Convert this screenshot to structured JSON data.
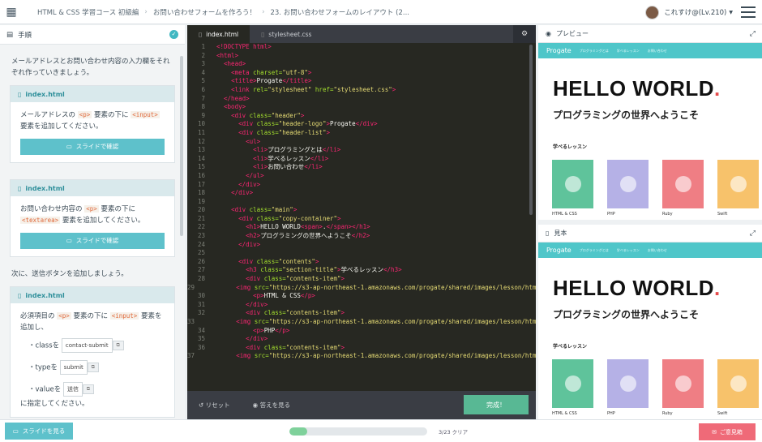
{
  "header": {
    "logo_icon": "progate-logo-icon",
    "breadcrumbs": [
      "HTML & CSS 学習コース 初級編",
      "お問い合わせフォームを作ろう！",
      "23. お問い合わせフォームのレイアウト (2..."
    ],
    "user_name": "これすけ@(Lv.210)",
    "menu_icon": "hamburger-icon"
  },
  "left_panel": {
    "title": "手順",
    "intro": "メールアドレスとお問い合わせ内容の入力欄をそれぞれ作っていきましょう。",
    "cards": [
      {
        "file": "index.html",
        "pre": "メールアドレスの",
        "code1": "<p>",
        "mid": "要素の下に",
        "code2": "<input>",
        "post": "要素を追加してください。",
        "button": "スライドで確認"
      },
      {
        "file": "index.html",
        "pre": "お問い合わせ内容の",
        "code1": "<p>",
        "mid": "要素の下に",
        "code2": "<textarea>",
        "post": "要素を追加してください。",
        "button": "スライドで確認"
      }
    ],
    "next_text": "次に、送信ボタンを追加しましょう。",
    "card3": {
      "file": "index.html",
      "pre": "必須項目の",
      "code1": "<p>",
      "mid": "要素の下に",
      "code2": "<input>",
      "post": "要素を追加し、",
      "attrs": [
        {
          "name": "class",
          "suffix": "を",
          "value": "contact-submit"
        },
        {
          "name": "type",
          "suffix": "を",
          "value": "submit"
        },
        {
          "name": "value",
          "suffix": "を",
          "value": "送信"
        }
      ],
      "tail": "に指定してください。"
    }
  },
  "editor": {
    "tabs": [
      "index.html",
      "stylesheet.css"
    ],
    "reset_label": "リセット",
    "answer_label": "答えを見る",
    "done_label": "完成！",
    "lines": [
      [
        [
          "t",
          "<!DOCTYPE html>"
        ]
      ],
      [
        [
          "t",
          "<html>"
        ]
      ],
      [
        [
          "p",
          "  "
        ],
        [
          "t",
          "<head>"
        ]
      ],
      [
        [
          "p",
          "    "
        ],
        [
          "t",
          "<meta "
        ],
        [
          "a",
          "charset="
        ],
        [
          "s",
          "\"utf-8\""
        ],
        [
          "t",
          ">"
        ]
      ],
      [
        [
          "p",
          "    "
        ],
        [
          "t",
          "<title>"
        ],
        [
          "p",
          "Progate"
        ],
        [
          "t",
          "</title>"
        ]
      ],
      [
        [
          "p",
          "    "
        ],
        [
          "t",
          "<link "
        ],
        [
          "a",
          "rel="
        ],
        [
          "s",
          "\"stylesheet\" "
        ],
        [
          "a",
          "href="
        ],
        [
          "s",
          "\"stylesheet.css\""
        ],
        [
          "t",
          ">"
        ]
      ],
      [
        [
          "p",
          "  "
        ],
        [
          "t",
          "</head>"
        ]
      ],
      [
        [
          "p",
          "  "
        ],
        [
          "t",
          "<body>"
        ]
      ],
      [
        [
          "p",
          "    "
        ],
        [
          "t",
          "<div "
        ],
        [
          "a",
          "class="
        ],
        [
          "s",
          "\"header\""
        ],
        [
          "t",
          ">"
        ]
      ],
      [
        [
          "p",
          "      "
        ],
        [
          "t",
          "<div "
        ],
        [
          "a",
          "class="
        ],
        [
          "s",
          "\"header-logo\""
        ],
        [
          "t",
          ">"
        ],
        [
          "p",
          "Progate"
        ],
        [
          "t",
          "</div>"
        ]
      ],
      [
        [
          "p",
          "      "
        ],
        [
          "t",
          "<div "
        ],
        [
          "a",
          "class="
        ],
        [
          "s",
          "\"header-list\""
        ],
        [
          "t",
          ">"
        ]
      ],
      [
        [
          "p",
          "        "
        ],
        [
          "t",
          "<ul>"
        ]
      ],
      [
        [
          "p",
          "          "
        ],
        [
          "t",
          "<li>"
        ],
        [
          "p",
          "プログラミングとは"
        ],
        [
          "t",
          "</li>"
        ]
      ],
      [
        [
          "p",
          "          "
        ],
        [
          "t",
          "<li>"
        ],
        [
          "p",
          "学べるレッスン"
        ],
        [
          "t",
          "</li>"
        ]
      ],
      [
        [
          "p",
          "          "
        ],
        [
          "t",
          "<li>"
        ],
        [
          "p",
          "お問い合わせ"
        ],
        [
          "t",
          "</li>"
        ]
      ],
      [
        [
          "p",
          "        "
        ],
        [
          "t",
          "</ul>"
        ]
      ],
      [
        [
          "p",
          "      "
        ],
        [
          "t",
          "</div>"
        ]
      ],
      [
        [
          "p",
          "    "
        ],
        [
          "t",
          "</div>"
        ]
      ],
      [
        [
          "p",
          ""
        ]
      ],
      [
        [
          "p",
          "    "
        ],
        [
          "t",
          "<div "
        ],
        [
          "a",
          "class="
        ],
        [
          "s",
          "\"main\""
        ],
        [
          "t",
          ">"
        ]
      ],
      [
        [
          "p",
          "      "
        ],
        [
          "t",
          "<div "
        ],
        [
          "a",
          "class="
        ],
        [
          "s",
          "\"copy-container\""
        ],
        [
          "t",
          ">"
        ]
      ],
      [
        [
          "p",
          "        "
        ],
        [
          "t",
          "<h1>"
        ],
        [
          "p",
          "HELLO WORLD"
        ],
        [
          "t",
          "<span>"
        ],
        [
          "p",
          "."
        ],
        [
          "t",
          "</span></h1>"
        ]
      ],
      [
        [
          "p",
          "        "
        ],
        [
          "t",
          "<h2>"
        ],
        [
          "p",
          "プログラミングの世界へようこそ"
        ],
        [
          "t",
          "</h2>"
        ]
      ],
      [
        [
          "p",
          "      "
        ],
        [
          "t",
          "</div>"
        ]
      ],
      [
        [
          "p",
          ""
        ]
      ],
      [
        [
          "p",
          "      "
        ],
        [
          "t",
          "<div "
        ],
        [
          "a",
          "class="
        ],
        [
          "s",
          "\"contents\""
        ],
        [
          "t",
          ">"
        ]
      ],
      [
        [
          "p",
          "        "
        ],
        [
          "t",
          "<h3 "
        ],
        [
          "a",
          "class="
        ],
        [
          "s",
          "\"section-title\""
        ],
        [
          "t",
          ">"
        ],
        [
          "p",
          "学べるレッスン"
        ],
        [
          "t",
          "</h3>"
        ]
      ],
      [
        [
          "p",
          "        "
        ],
        [
          "t",
          "<div "
        ],
        [
          "a",
          "class="
        ],
        [
          "s",
          "\"contents-item\""
        ],
        [
          "t",
          ">"
        ]
      ],
      [
        [
          "p",
          "          "
        ],
        [
          "t",
          "<img "
        ],
        [
          "a",
          "src="
        ],
        [
          "s",
          "\"https://s3-ap-northeast-1.amazonaws.com/progate/shared/images/lesson/html/html.svg\""
        ],
        [
          "t",
          ">"
        ]
      ],
      [
        [
          "p",
          "          "
        ],
        [
          "t",
          "<p>"
        ],
        [
          "p",
          "HTML & CSS"
        ],
        [
          "t",
          "</p>"
        ]
      ],
      [
        [
          "p",
          "        "
        ],
        [
          "t",
          "</div>"
        ]
      ],
      [
        [
          "p",
          "        "
        ],
        [
          "t",
          "<div "
        ],
        [
          "a",
          "class="
        ],
        [
          "s",
          "\"contents-item\""
        ],
        [
          "t",
          ">"
        ]
      ],
      [
        [
          "p",
          "          "
        ],
        [
          "t",
          "<img "
        ],
        [
          "a",
          "src="
        ],
        [
          "s",
          "\"https://s3-ap-northeast-1.amazonaws.com/progate/shared/images/lesson/html/php.svg\""
        ],
        [
          "t",
          ">"
        ]
      ],
      [
        [
          "p",
          "          "
        ],
        [
          "t",
          "<p>"
        ],
        [
          "p",
          "PHP"
        ],
        [
          "t",
          "</p>"
        ]
      ],
      [
        [
          "p",
          "        "
        ],
        [
          "t",
          "</div>"
        ]
      ],
      [
        [
          "p",
          "        "
        ],
        [
          "t",
          "<div "
        ],
        [
          "a",
          "class="
        ],
        [
          "s",
          "\"contents-item\""
        ],
        [
          "t",
          ">"
        ]
      ],
      [
        [
          "p",
          "          "
        ],
        [
          "t",
          "<img "
        ],
        [
          "a",
          "src="
        ],
        [
          "s",
          "\"https://s3-ap-northeast-1.amazonaws.com/progate/shared/images/lesson/html/ruby.svg\""
        ],
        [
          "t",
          ">"
        ]
      ]
    ]
  },
  "preview": {
    "title": "プレビュー",
    "sample_title": "見本",
    "brand": "Progate",
    "nav_items": [
      "プログラミングとは",
      "学べるレッスン",
      "お問い合わせ"
    ],
    "hello": "HELLO WORLD",
    "dot": ".",
    "subtitle": "プログラミングの世界へようこそ",
    "lessons_title": "学べるレッスン",
    "items": [
      {
        "label": "HTML & CSS",
        "color": "#5fc39b"
      },
      {
        "label": "PHP",
        "color": "#b5b1e6"
      },
      {
        "label": "Ruby",
        "color": "#ef7e84"
      },
      {
        "label": "Swift",
        "color": "#f7c26b"
      }
    ]
  },
  "footer": {
    "slide_button": "スライドを見る",
    "progress_fraction": 0.1304,
    "progress_text": "3/23 クリア",
    "feedback_button": "ご意見箱"
  }
}
